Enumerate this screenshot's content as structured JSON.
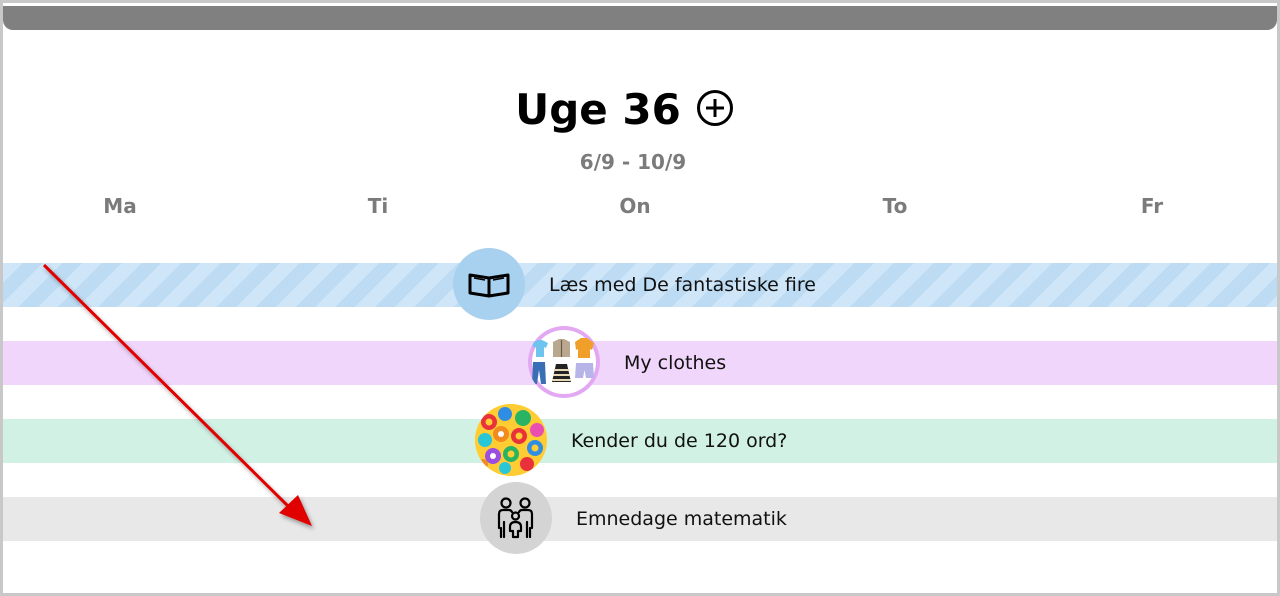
{
  "week": {
    "title": "Uge 36",
    "date_range": "6/9 - 10/9"
  },
  "days": [
    "Ma",
    "Ti",
    "On",
    "To",
    "Fr"
  ],
  "activities": [
    {
      "label": "Læs med De fantastiske fire",
      "icon": "open-book-icon",
      "color": "#cfe5f8"
    },
    {
      "label": "My clothes",
      "icon": "clothes-icon",
      "color": "#f1d6fb"
    },
    {
      "label": "Kender du de 120 ord?",
      "icon": "letters-icon",
      "color": "#d2f1e5"
    },
    {
      "label": "Emnedage matematik",
      "icon": "family-icon",
      "color": "#e8e8e8"
    }
  ],
  "annotation": {
    "color": "#e00000"
  }
}
